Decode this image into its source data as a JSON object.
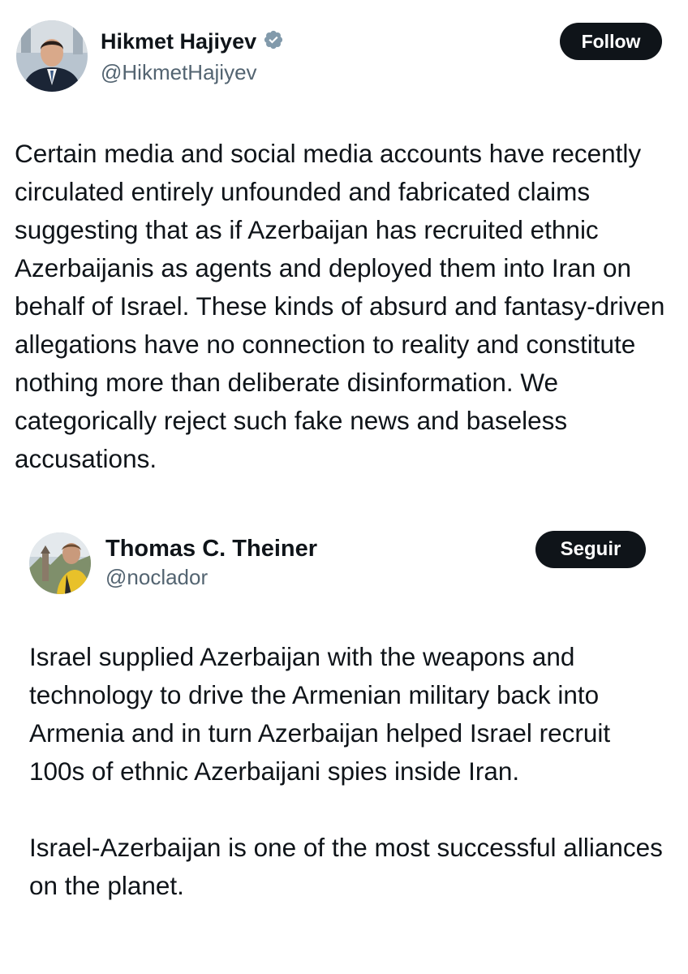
{
  "main_tweet": {
    "author": {
      "display_name": "Hikmet Hajiyev",
      "handle": "@HikmetHajiyev",
      "verified": true,
      "avatar": "profile-photo"
    },
    "follow_label": "Follow",
    "text": "Certain media and social media accounts have recently circulated entirely unfounded and fabricated claims suggesting that as if Azerbaijan has recruited ethnic Azerbaijanis as agents and deployed them into Iran on behalf of Israel. These kinds of absurd and fantasy-driven allegations have no connection to reality and constitute nothing more than deliberate disinformation. We categorically reject such fake news and baseless accusations."
  },
  "reply_tweet": {
    "author": {
      "display_name": "Thomas C. Theiner",
      "handle": "@noclador",
      "verified": false,
      "avatar": "profile-photo"
    },
    "follow_label": "Seguir",
    "paragraphs": [
      "Israel supplied Azerbaijan with the weapons and technology to drive the Armenian military back into Armenia and in turn Azerbaijan helped Israel recruit 100s of ethnic Azerbaijani spies inside Iran.",
      "Israel-Azerbaijan is one of the most successful alliances on the planet."
    ]
  },
  "colors": {
    "text": "#0f1419",
    "secondary": "#536471",
    "button_bg": "#0f1419",
    "button_text": "#ffffff",
    "verified_badge": "#829aab"
  }
}
